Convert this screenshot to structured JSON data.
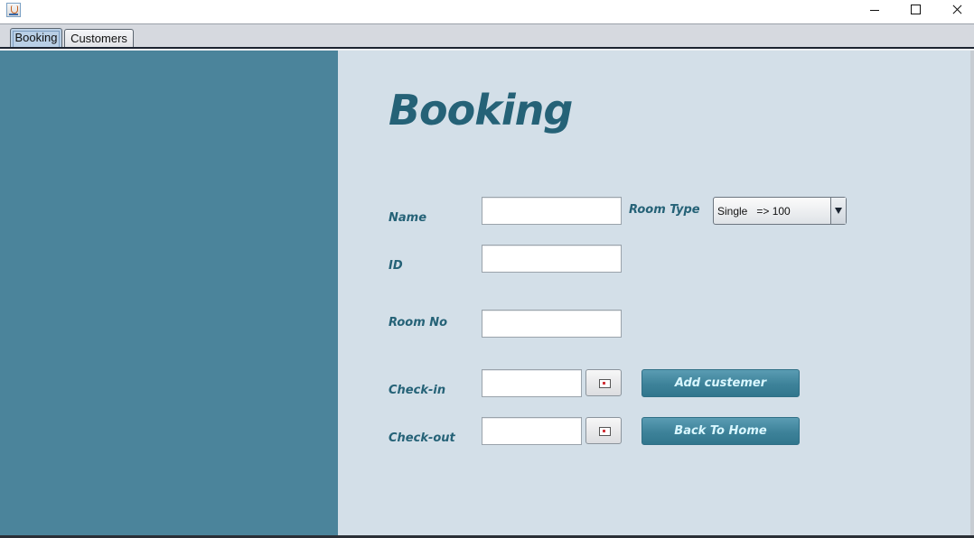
{
  "window": {
    "icon": "java-cup-icon"
  },
  "tabs": [
    {
      "label": "Booking",
      "selected": true
    },
    {
      "label": "Customers",
      "selected": false
    }
  ],
  "form": {
    "heading": "Booking",
    "name_label": "Name",
    "name_value": "",
    "id_label": "ID",
    "id_value": "",
    "room_no_label": "Room No",
    "room_no_value": "",
    "room_type_label": "Room Type",
    "room_type_selected": "Single   => 100",
    "checkin_label": "Check-in",
    "checkin_value": "",
    "checkout_label": "Check-out",
    "checkout_value": "",
    "add_button": "Add custemer",
    "back_button": "Back To Home"
  },
  "colors": {
    "left_panel": "#4b849b",
    "form_bg": "#d3dfe8",
    "accent_text": "#256277",
    "button_bg": "#3d8299",
    "button_text": "#d9f7ff"
  }
}
